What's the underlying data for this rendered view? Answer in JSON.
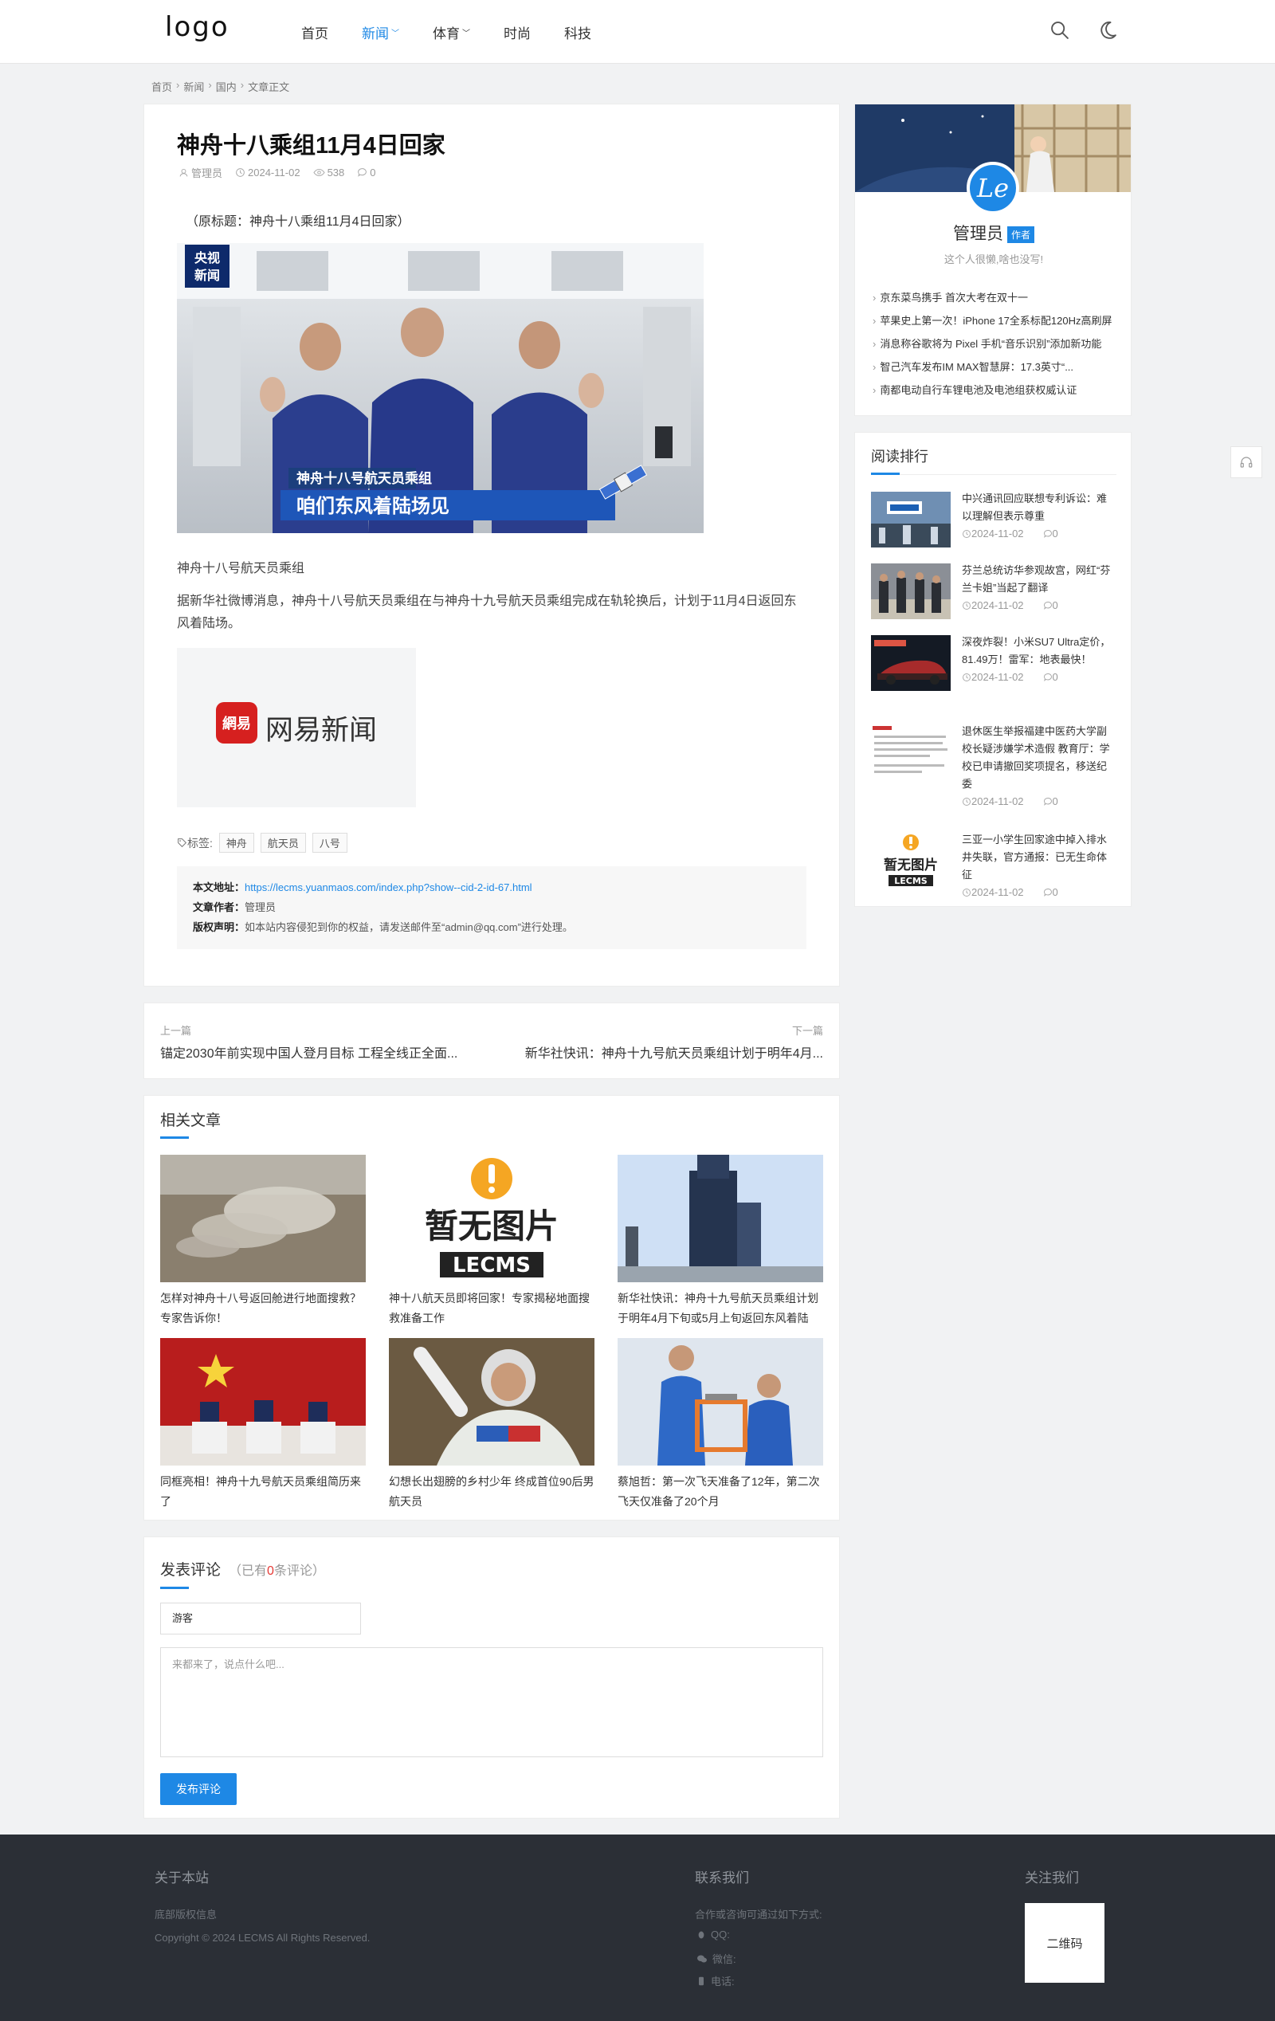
{
  "header": {
    "logo": "logo",
    "nav": [
      {
        "label": "首页",
        "active": false,
        "dropdown": false
      },
      {
        "label": "新闻",
        "active": true,
        "dropdown": true
      },
      {
        "label": "体育",
        "active": false,
        "dropdown": true
      },
      {
        "label": "时尚",
        "active": false,
        "dropdown": false
      },
      {
        "label": "科技",
        "active": false,
        "dropdown": false
      }
    ],
    "icons": [
      "search-icon",
      "moon-icon"
    ],
    "accent": "#1e88e5"
  },
  "breadcrumb": [
    "首页",
    "新闻",
    "国内",
    "文章正文"
  ],
  "article": {
    "title": "神舟十八乘组11月4日回家",
    "author": "管理员",
    "date": "2024-11-02",
    "views": "538",
    "comments": "0",
    "subtitle": "（原标题：神舟十八乘组11月4日回家）",
    "image1": {
      "badge_top": "央视",
      "badge_bottom": "新闻",
      "banner_small": "神舟十八号航天员乘组",
      "banner_large": "咱们东风着陆场见"
    },
    "caption": "神舟十八号航天员乘组",
    "paragraph": "据新华社微博消息，神舟十八号航天员乘组在与神舟十九号航天员乘组完成在轨轮换后，计划于11月4日返回东风着陆场。",
    "image2": {
      "logo_text": "網易",
      "name": "网易新闻"
    },
    "tags_label": "标签:",
    "tags": [
      "神舟",
      "航天员",
      "八号"
    ],
    "copyright": {
      "url_label": "本文地址：",
      "url": "https://lecms.yuanmaos.com/index.php?show--cid-2-id-67.html",
      "author_label": "文章作者：",
      "author": "管理员",
      "notice_label": "版权声明：",
      "notice": "如本站内容侵犯到你的权益，请发送邮件至“admin@qq.com”进行处理。"
    }
  },
  "prevnext": {
    "prev_label": "上一篇",
    "prev_title": "锚定2030年前实现中国人登月目标 工程全线正全面...",
    "next_label": "下一篇",
    "next_title": "新华社快讯：神舟十九号航天员乘组计划于明年4月..."
  },
  "related": {
    "title": "相关文章",
    "items": [
      {
        "title": "怎样对神舟十八号返回舱进行地面搜救？专家告诉你！"
      },
      {
        "title": "神十八航天员即将回家！专家揭秘地面搜救准备工作",
        "placeholder_top": "暂无图片",
        "placeholder_bottom": "LECMS"
      },
      {
        "title": "新华社快讯：神舟十九号航天员乘组计划于明年4月下旬或5月上旬返回东风着陆"
      },
      {
        "title": "同框亮相！神舟十九号航天员乘组简历来了"
      },
      {
        "title": "幻想长出翅膀的乡村少年 终成首位90后男航天员"
      },
      {
        "title": "蔡旭哲：第一次飞天准备了12年，第二次飞天仅准备了20个月"
      }
    ]
  },
  "comment": {
    "title": "发表评论",
    "count_prefix": "（已有",
    "count": "0",
    "count_suffix": "条评论）",
    "name_value": "游客",
    "textarea_placeholder": "来都来了，说点什么吧...",
    "submit": "发布评论"
  },
  "author_card": {
    "avatar_text": "Le",
    "name": "管理员",
    "badge": "作者",
    "desc": "这个人很懒,啥也没写!",
    "links": [
      "京东菜鸟携手 首次大考在双十一",
      "苹果史上第一次！iPhone 17全系标配120Hz高刷屏",
      "消息称谷歌将为 Pixel 手机“音乐识别”添加新功能",
      "智己汽车发布IM MAX智慧屏：17.3英寸“...",
      "南都电动自行车锂电池及电池组获权威认证"
    ]
  },
  "rank": {
    "title": "阅读排行",
    "items": [
      {
        "title": "中兴通讯回应联想专利诉讼：难以理解但表示尊重",
        "date": "2024-11-02",
        "comments": "0"
      },
      {
        "title": "芬兰总统访华参观故宫，网红“芬兰卡姐”当起了翻译",
        "date": "2024-11-02",
        "comments": "0"
      },
      {
        "title": "深夜炸裂！小米SU7 Ultra定价，81.49万！雷军：地表最快！",
        "date": "2024-11-02",
        "comments": "0"
      },
      {
        "title": "退休医生举报福建中医药大学副校长疑涉嫌学术造假 教育厅：学校已申请撤回奖项提名，移送纪委",
        "date": "2024-11-02",
        "comments": "0"
      },
      {
        "title": "三亚一小学生回家途中掉入排水井失联，官方通报：已无生命体征",
        "date": "2024-11-02",
        "comments": "0",
        "placeholder_top": "暂无图片",
        "placeholder_bottom": "LECMS"
      }
    ]
  },
  "footer": {
    "about_title": "关于本站",
    "about_text": "底部版权信息",
    "copyright": "Copyright © 2024 LECMS All Rights Reserved.",
    "contact_title": "联系我们",
    "contact_intro": "合作或咨询可通过如下方式:",
    "qq": "QQ:",
    "wechat": "微信:",
    "phone": "电话:",
    "follow_title": "关注我们",
    "qr": "二维码"
  }
}
